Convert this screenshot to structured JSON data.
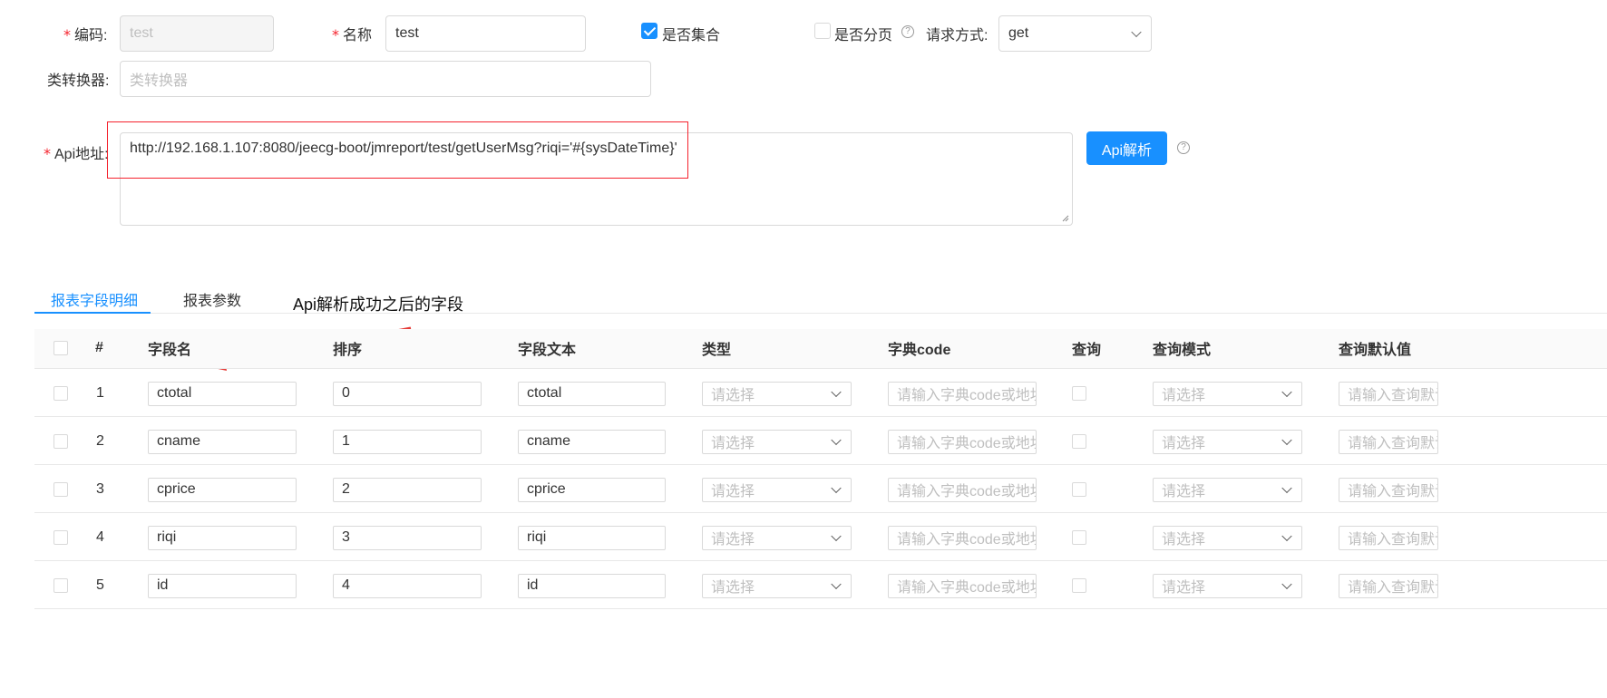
{
  "form": {
    "code": {
      "label": "编码:",
      "value": "test"
    },
    "name": {
      "label": "名称",
      "value": "test"
    },
    "is_collection": {
      "label": "是否集合",
      "checked": true
    },
    "is_paged": {
      "label": "是否分页",
      "checked": false
    },
    "request_method": {
      "label": "请求方式:",
      "value": "get"
    },
    "converter": {
      "label": "类转换器:",
      "placeholder": "类转换器"
    },
    "api_url": {
      "label": "Api地址:",
      "value": "http://192.168.1.107:8080/jeecg-boot/jmreport/test/getUserMsg?riqi='#{sysDateTime}'"
    },
    "parse_button": "Api解析",
    "help_glyph": "?"
  },
  "tabs": [
    {
      "label": "报表字段明细",
      "active": true
    },
    {
      "label": "报表参数",
      "active": false
    }
  ],
  "annotation": "Api解析成功之后的字段",
  "table": {
    "columns": [
      "#",
      "字段名",
      "排序",
      "字段文本",
      "类型",
      "字典code",
      "查询",
      "查询模式",
      "查询默认值"
    ],
    "select_placeholder": "请选择",
    "dict_placeholder": "请输入字典code或地址",
    "default_placeholder": "请输入查询默认值",
    "rows": [
      {
        "index": "1",
        "field_name": "ctotal",
        "order": "0",
        "field_text": "ctotal"
      },
      {
        "index": "2",
        "field_name": "cname",
        "order": "1",
        "field_text": "cname"
      },
      {
        "index": "3",
        "field_name": "cprice",
        "order": "2",
        "field_text": "cprice"
      },
      {
        "index": "4",
        "field_name": "riqi",
        "order": "3",
        "field_text": "riqi"
      },
      {
        "index": "5",
        "field_name": "id",
        "order": "4",
        "field_text": "id"
      }
    ]
  },
  "colors": {
    "primary": "#1890ff",
    "required": "#f5222d",
    "annotation_red": "#e53935"
  }
}
